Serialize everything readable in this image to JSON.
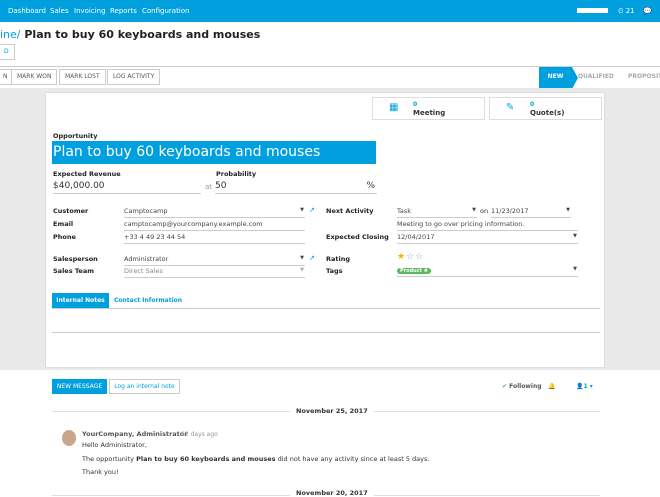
{
  "nav": {
    "menu": [
      "Dashboard",
      "Sales",
      "Invoicing",
      "Reports",
      "Configuration"
    ],
    "notifications": "21"
  },
  "breadcrumb": {
    "parent": "ine",
    "sep": "/",
    "title": "Plan to buy 60 keyboards and mouses"
  },
  "control": {
    "edit_partial": "D"
  },
  "actions": {
    "partial": "N",
    "mark_won": "MARK WON",
    "mark_lost": "MARK LOST",
    "log_activity": "LOG ACTIVITY"
  },
  "stages": {
    "new": "NEW",
    "qualified": "QUALIFIED",
    "proposition": "PROPOSIT"
  },
  "smart_buttons": {
    "meeting_count": "0",
    "meeting": "Meeting",
    "quote_count": "0",
    "quote": "Quote(s)"
  },
  "form": {
    "opportunity_label": "Opportunity",
    "name": "Plan to buy 60 keyboards and mouses",
    "revenue_label": "Expected Revenue",
    "revenue": "$40,000.00",
    "probability_label": "Probability",
    "at": "at",
    "probability": "50",
    "pct": "%",
    "customer_label": "Customer",
    "customer": "Camptocamp",
    "email_label": "Email",
    "email": "camptocamp@yourcompany.example.com",
    "phone_label": "Phone",
    "phone": "+33 4 49 23 44 54",
    "salesperson_label": "Salesperson",
    "salesperson": "Administrator",
    "team_label": "Sales Team",
    "team": "Direct Sales",
    "activity_label": "Next Activity",
    "activity": "Task",
    "on": "on",
    "activity_date": "11/23/2017",
    "activity_summary": "Meeting to go over pricing information.",
    "closing_label": "Expected Closing",
    "closing": "12/04/2017",
    "rating_label": "Rating",
    "rating": 1,
    "rating_max": 3,
    "tags_label": "Tags",
    "tag": "Product",
    "tabs": [
      "Internal Notes",
      "Contact Information"
    ]
  },
  "chatter": {
    "new_message": "NEW MESSAGE",
    "log_note": "Log an internal note",
    "following": "Following",
    "followers": "1",
    "date1": "November 25, 2017",
    "author": "YourCompany, Administrator",
    "ago": "- 12 days ago",
    "line1": "Hello Administrator,",
    "line2a": "The opportunity ",
    "line2b": "Plan to buy 60 keyboards and mouses",
    "line2c": " did not have any activity since at least 5 days.",
    "line3": "Thank you!",
    "date2": "November 20, 2017"
  }
}
